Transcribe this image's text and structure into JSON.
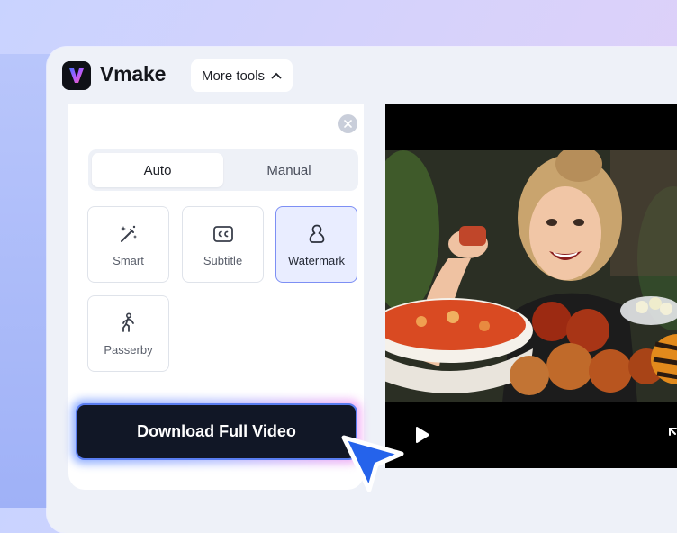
{
  "app": {
    "name": "Vmake"
  },
  "header": {
    "more_tools_label": "More tools"
  },
  "panel": {
    "tabs": [
      {
        "label": "Auto"
      },
      {
        "label": "Manual"
      }
    ],
    "tools": [
      {
        "label": "Smart",
        "icon": "magic-wand-icon"
      },
      {
        "label": "Subtitle",
        "icon": "cc-icon"
      },
      {
        "label": "Watermark",
        "icon": "watermark-icon",
        "selected": true
      },
      {
        "label": "Passerby",
        "icon": "walking-person-icon"
      }
    ],
    "download_label": "Download Full Video"
  },
  "colors": {
    "accent": "#5a7df0",
    "selected_card_bg": "#e9edff",
    "download_bg": "#111726"
  }
}
